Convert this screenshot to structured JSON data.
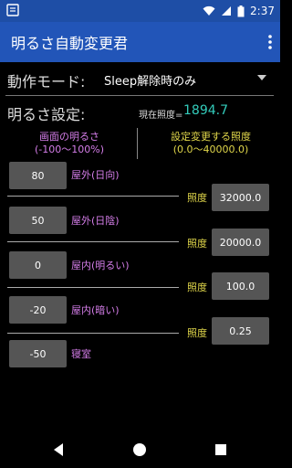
{
  "status": {
    "time": "2:37"
  },
  "appbar": {
    "title": "明るさ自動変更君"
  },
  "mode": {
    "label": "動作モード:",
    "value": "Sleep解除時のみ"
  },
  "settings": {
    "title": "明るさ設定:",
    "current_lux_label": "現在照度=",
    "current_lux_value": "1894.7"
  },
  "columns": {
    "left_line1": "画面の明るさ",
    "left_line2": "(-100〜100%)",
    "right_line1": "設定変更する照度",
    "right_line2": "(0.0〜40000.0)"
  },
  "scenes": [
    {
      "value": "80",
      "label": "屋外(日向)"
    },
    {
      "value": "50",
      "label": "屋外(日陰)"
    },
    {
      "value": "0",
      "label": "屋内(明るい)"
    },
    {
      "value": "-20",
      "label": "屋内(暗い)"
    },
    {
      "value": "-50",
      "label": "寝室"
    }
  ],
  "thresholds": [
    {
      "label": "照度",
      "value": "32000.0"
    },
    {
      "label": "照度",
      "value": "20000.0"
    },
    {
      "label": "照度",
      "value": "100.0"
    },
    {
      "label": "照度",
      "value": "0.25"
    }
  ],
  "colors": {
    "appbar": "#2255b8",
    "statusbar": "#1e4ea6",
    "scene_label": "#d47de8",
    "threshold_label": "#e0d64a",
    "lux_value": "#33ccbb"
  }
}
